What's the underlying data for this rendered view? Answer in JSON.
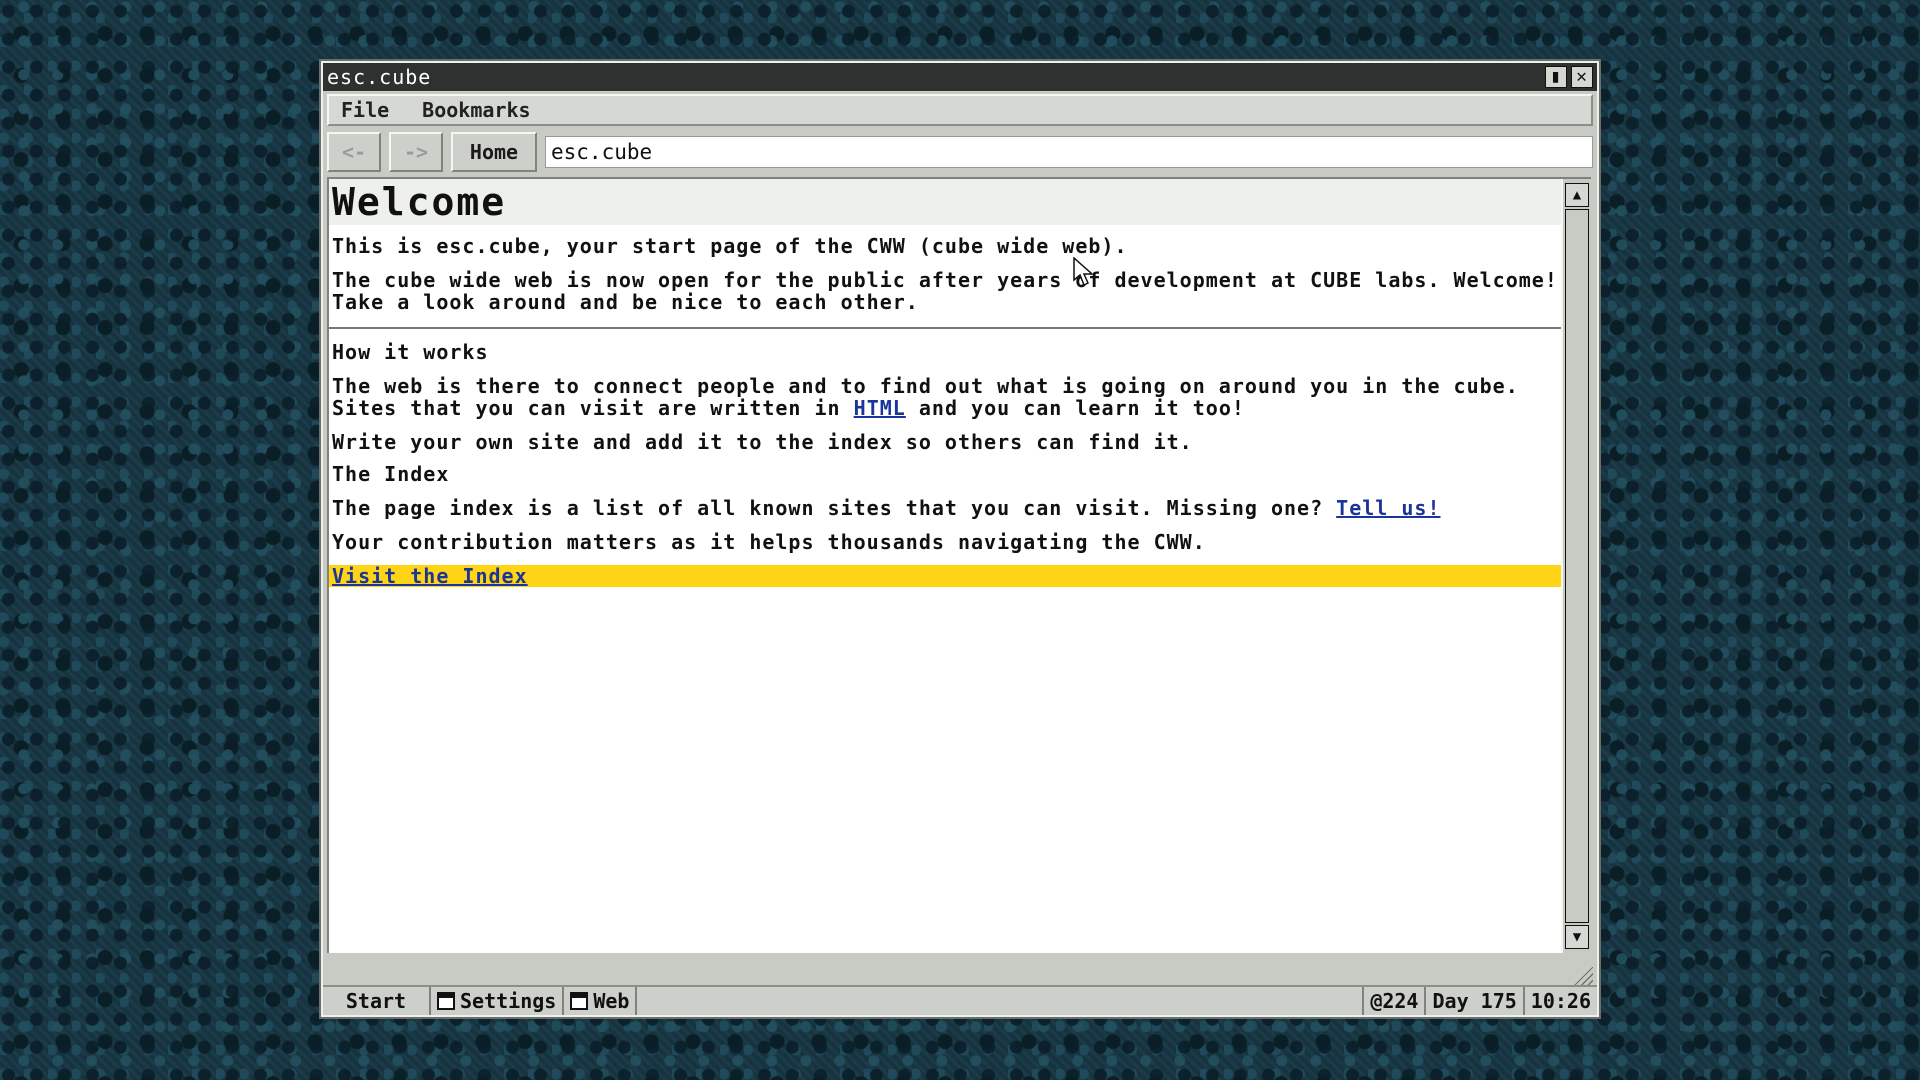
{
  "window": {
    "title": "esc.cube"
  },
  "menu": {
    "file_label": "File",
    "bookmarks_label": "Bookmarks"
  },
  "toolbar": {
    "back_label": "<-",
    "forward_label": "->",
    "home_label": "Home",
    "address_value": "esc.cube"
  },
  "page": {
    "title": "Welcome",
    "intro_1": "This is esc.cube, your start page of the CWW (cube wide web).",
    "intro_2": "The cube wide web is now open for the public after years of development at CUBE labs. Welcome! Take a look around and be nice to each other.",
    "how_title": "How it works",
    "how_1_before": "The web is there to connect people and to find out what is going on around you in the cube. Sites that you can visit are written in",
    "how_1_link": "HTML",
    "how_1_after": "and you can learn it too!",
    "how_2": "Write your own site and add it to the index so others can find it.",
    "index_title": "The Index",
    "index_1_before": "The page index is a list of all known sites that you can visit. Missing one?",
    "index_1_link": "Tell us!",
    "index_2": "Your contribution matters as it helps thousands navigating the CWW.",
    "visit_link": "Visit the Index"
  },
  "taskbar": {
    "start_label": "Start",
    "settings_label": "Settings",
    "web_label": "Web",
    "credits": "@224",
    "day": "Day 175",
    "time": "10:26"
  },
  "icons": {
    "maximize": "restore-icon",
    "close": "close-icon",
    "scroll_up": "arrow-up-icon",
    "scroll_down": "arrow-down-icon",
    "resize": "resize-grip-icon"
  },
  "colors": {
    "highlight": "#ffd414",
    "link": "#1b349b",
    "titlebar": "#2f3030"
  }
}
